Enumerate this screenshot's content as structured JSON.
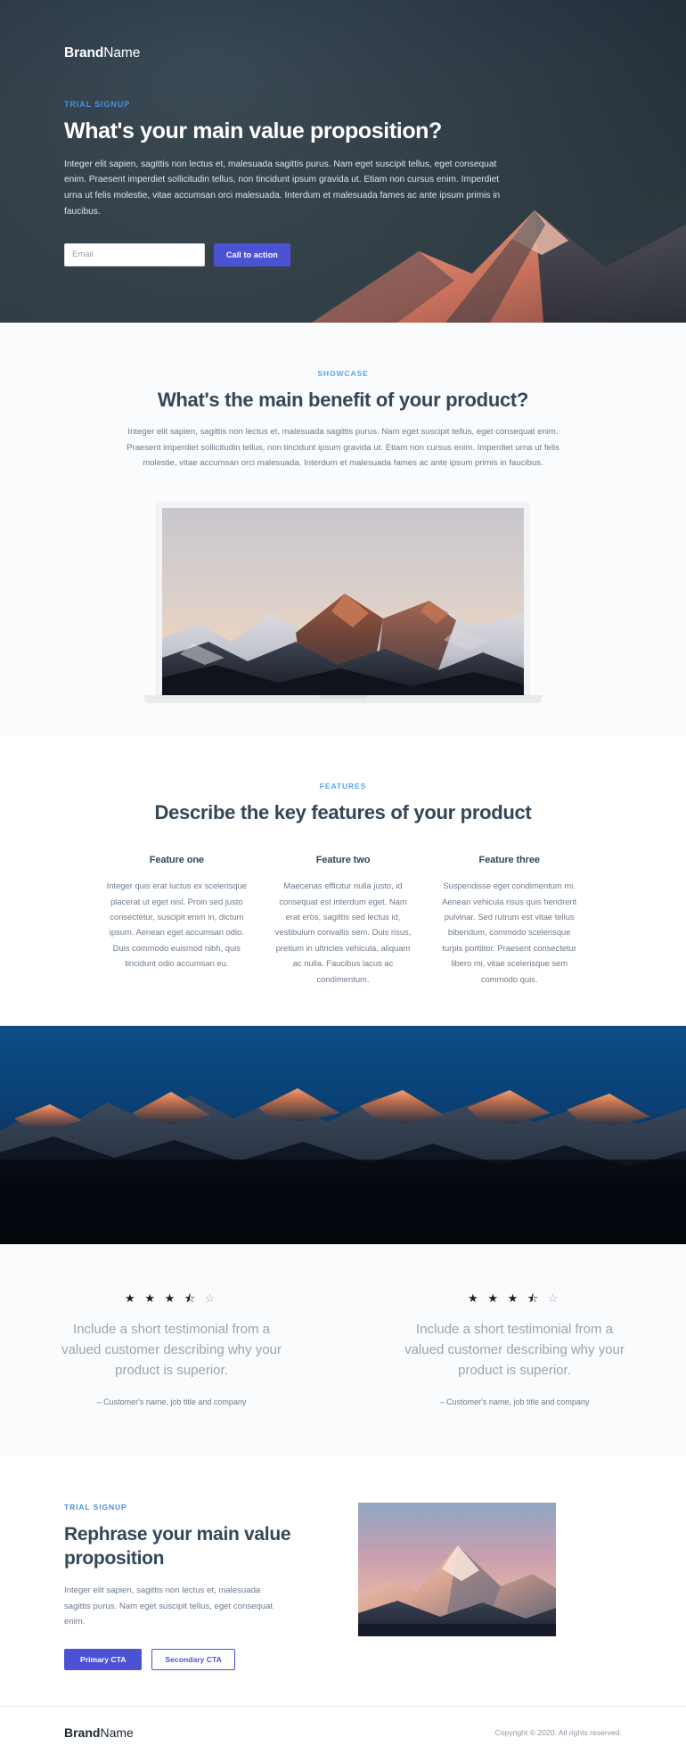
{
  "brand": {
    "bold": "Brand",
    "light": "Name"
  },
  "hero": {
    "eyebrow": "TRIAL SIGNUP",
    "heading": "What's your main value proposition?",
    "body": "Integer elit sapien, sagittis non lectus et, malesuada sagittis purus. Nam eget suscipit tellus, eget consequat enim. Praesent imperdiet sollicitudin tellus, non tincidunt ipsum gravida ut. Etiam non cursus enim. Imperdiet urna ut felis molestie, vitae accumsan orci malesuada. Interdum et malesuada fames ac ante ipsum primis in faucibus.",
    "email_placeholder": "Email",
    "email_value": "",
    "cta_label": "Call to action",
    "accent_color": "#4a90e2",
    "button_color": "#4c52d4",
    "background_color": "#36454f"
  },
  "showcase": {
    "eyebrow": "SHOWCASE",
    "heading": "What's the main benefit of your product?",
    "body": "Integer elit sapien, sagittis non lectus et, malesuada sagittis purus. Nam eget suscipit tellus, eget consequat enim. Praesent imperdiet sollicitudin tellus, non tincidunt ipsum gravida ut. Etiam non cursus enim. Imperdiet urna ut felis molestie, vitae accumsan orci malesuada. Interdum et malesuada fames ac ante ipsum primis in faucibus.",
    "device": "laptop-mockup",
    "device_image_alt": "snow-capped-mountain-range-at-sunset"
  },
  "features": {
    "eyebrow": "FEATURES",
    "heading": "Describe the key features of your product",
    "items": [
      {
        "title": "Feature one",
        "body": "Integer quis erat luctus ex scelerisque placerat ut eget nisl. Proin sed justo consectetur, suscipit enim in, dictum ipsum. Aenean eget accumsan odio. Duis commodo euismod nibh, quis tincidunt odio accumsan eu."
      },
      {
        "title": "Feature two",
        "body": "Maecenas efficitur nulla justo, id consequat est interdum eget. Nam erat eros, sagittis sed lectus id, vestibulum convallis sem. Duis risus, pretium in ultricies vehicula, aliquam ac nulla. Faucibus lacus ac condimentum."
      },
      {
        "title": "Feature three",
        "body": "Suspendisse eget condimentum mi. Aenean vehicula risus quis hendrerit pulvinar. Sed rutrum est vitae tellus bibendum, commodo scelerisque turpis porttitor. Praesent consectetur libero mi, vitae scelerisque sem commodo quis."
      }
    ]
  },
  "band": {
    "image_alt": "mountain-ridge-at-blue-hour"
  },
  "testimonials": {
    "items": [
      {
        "rating": 3.5,
        "stars_full": 3,
        "stars_half": 1,
        "stars_empty": 1,
        "quote": "Include a short testimonial from a valued customer describing why your product is superior.",
        "attribution": "– Customer's name, job title and company"
      },
      {
        "rating": 3.5,
        "stars_full": 3,
        "stars_half": 1,
        "stars_empty": 1,
        "quote": "Include a short testimonial from a valued customer describing why your product is superior.",
        "attribution": "– Customer's name, job title and company"
      }
    ]
  },
  "cta": {
    "eyebrow": "TRIAL SIGNUP",
    "heading": "Rephrase your main value proposition",
    "body": "Integer elit sapien, sagittis non lectus et, malesuada sagittis purus. Nam eget suscipit tellus, eget consequat enim.",
    "primary_label": "Primary CTA",
    "secondary_label": "Secondary CTA",
    "image_alt": "pink-lit-mountain-peak-at-dusk"
  },
  "footer": {
    "copyright": "Copyright © 2020. All rights reserved."
  }
}
